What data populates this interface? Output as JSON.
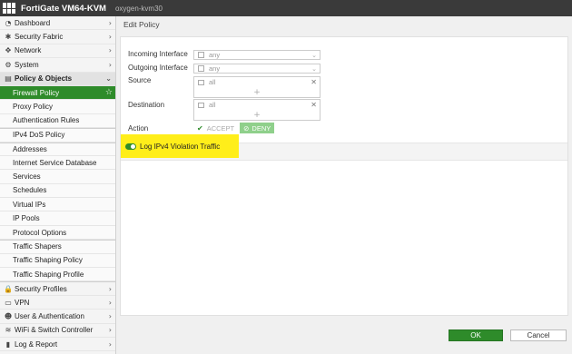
{
  "topbar": {
    "brand": "FortiGate VM64-KVM",
    "hostname": "oxygen-kvm30"
  },
  "sidebar": {
    "items": [
      {
        "label": "Dashboard",
        "icon": "dashboard-icon",
        "glyph": "◔",
        "chevron": "›"
      },
      {
        "label": "Security Fabric",
        "icon": "fabric-icon",
        "glyph": "✱",
        "chevron": "›"
      },
      {
        "label": "Network",
        "icon": "network-icon",
        "glyph": "✥",
        "chevron": "›"
      },
      {
        "label": "System",
        "icon": "gear-icon",
        "glyph": "⚙",
        "chevron": "›"
      },
      {
        "label": "Policy & Objects",
        "icon": "policy-icon",
        "glyph": "▤",
        "chevron": "⌄"
      },
      {
        "label": "Firewall Policy"
      },
      {
        "label": "Proxy Policy"
      },
      {
        "label": "Authentication Rules"
      },
      {
        "label": "IPv4 DoS Policy"
      },
      {
        "label": "Addresses"
      },
      {
        "label": "Internet Service Database"
      },
      {
        "label": "Services"
      },
      {
        "label": "Schedules"
      },
      {
        "label": "Virtual IPs"
      },
      {
        "label": "IP Pools"
      },
      {
        "label": "Protocol Options"
      },
      {
        "label": "Traffic Shapers"
      },
      {
        "label": "Traffic Shaping Policy"
      },
      {
        "label": "Traffic Shaping Profile"
      },
      {
        "label": "Security Profiles",
        "icon": "lock-icon",
        "glyph": "🔒",
        "chevron": "›"
      },
      {
        "label": "VPN",
        "icon": "monitor-icon",
        "glyph": "▭",
        "chevron": "›"
      },
      {
        "label": "User & Authentication",
        "icon": "user-icon",
        "glyph": "☻",
        "chevron": "›"
      },
      {
        "label": "WiFi & Switch Controller",
        "icon": "wifi-icon",
        "glyph": "≋",
        "chevron": "›"
      },
      {
        "label": "Log & Report",
        "icon": "chart-icon",
        "glyph": "▮",
        "chevron": "›"
      }
    ],
    "active_star": "☆"
  },
  "page": {
    "title": "Edit Policy"
  },
  "form": {
    "incoming_label": "Incoming Interface",
    "incoming_value": "any",
    "outgoing_label": "Outgoing Interface",
    "outgoing_value": "any",
    "source_label": "Source",
    "source_value": "all",
    "destination_label": "Destination",
    "destination_value": "all",
    "action_label": "Action",
    "accept_label": "ACCEPT",
    "deny_label": "DENY",
    "log_violation_label": "Log IPv4 Violation Traffic",
    "log_violation_enabled": true
  },
  "footer": {
    "ok_label": "OK",
    "cancel_label": "Cancel"
  },
  "colors": {
    "accent": "#2e8b2a",
    "deny_bg": "#8fd08b",
    "highlight": "#ffee1a",
    "topbar": "#3a3a3a"
  }
}
